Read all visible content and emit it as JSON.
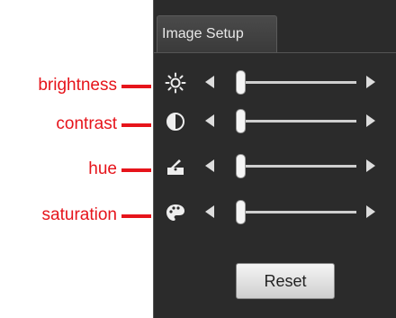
{
  "tab": {
    "title": "Image Setup"
  },
  "controls": [
    {
      "label": "brightness",
      "icon": "brightness-icon",
      "value": 0
    },
    {
      "label": "contrast",
      "icon": "contrast-icon",
      "value": 0
    },
    {
      "label": "hue",
      "icon": "hue-icon",
      "value": 0
    },
    {
      "label": "saturation",
      "icon": "saturation-icon",
      "value": 0
    }
  ],
  "reset": {
    "label": "Reset"
  },
  "colors": {
    "annotation": "#e6141b",
    "panel": "#2b2b2b"
  }
}
